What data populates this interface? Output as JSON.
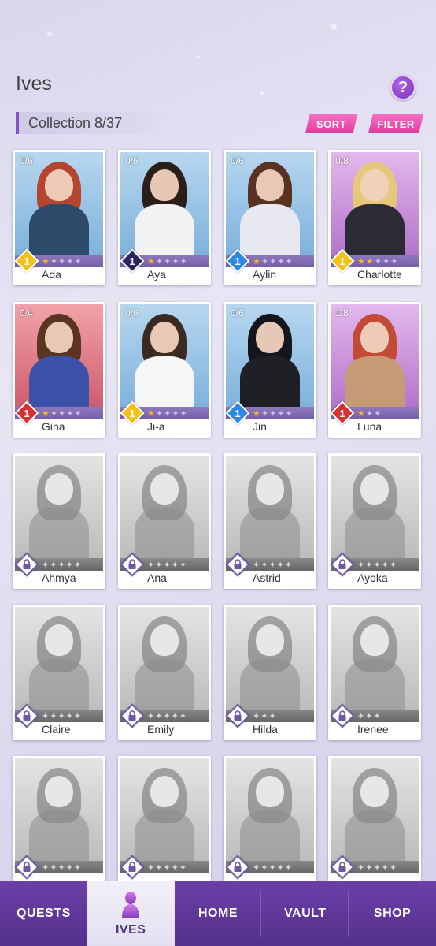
{
  "header": {
    "title": "Ives",
    "help_label": "?",
    "collection_label": "Collection 8/37",
    "sort_label": "SORT",
    "filter_label": "FILTER"
  },
  "colors": {
    "accent": "#7e54c8",
    "pill": "#e94aa8",
    "nav": "#5f37a0",
    "rarity_yellow": "#f3c21a",
    "rarity_navy": "#2a2560",
    "rarity_blue": "#2f88e0",
    "rarity_red": "#d63232"
  },
  "characters": [
    {
      "name": "Ada",
      "progress": "0/6",
      "level": "1",
      "rarity": "yellow",
      "stars_on": 1,
      "stars_total": 5,
      "bg": "blue",
      "locked": false,
      "hair": "#b5452e",
      "outfit": "#2d4a6a"
    },
    {
      "name": "Aya",
      "progress": "0/6",
      "level": "1",
      "rarity": "navy",
      "stars_on": 1,
      "stars_total": 5,
      "bg": "blue",
      "locked": false,
      "hair": "#2b1e18",
      "outfit": "#f2f2f2"
    },
    {
      "name": "Aylin",
      "progress": "0/6",
      "level": "1",
      "rarity": "blue",
      "stars_on": 1,
      "stars_total": 5,
      "bg": "blue",
      "locked": false,
      "hair": "#5a3224",
      "outfit": "#e8e8f0"
    },
    {
      "name": "Charlotte",
      "progress": "0/8",
      "level": "1",
      "rarity": "yellow",
      "stars_on": 2,
      "stars_total": 5,
      "bg": "purple",
      "locked": false,
      "hair": "#e7c77a",
      "outfit": "#2b2b36"
    },
    {
      "name": "Gina",
      "progress": "0/4",
      "level": "1",
      "rarity": "red",
      "stars_on": 1,
      "stars_total": 5,
      "bg": "red",
      "locked": false,
      "hair": "#5b3524",
      "outfit": "#3c52a8"
    },
    {
      "name": "Ji-a",
      "progress": "0/6",
      "level": "1",
      "rarity": "yellow",
      "stars_on": 1,
      "stars_total": 5,
      "bg": "blue",
      "locked": false,
      "hair": "#3a2a22",
      "outfit": "#f6f6f6"
    },
    {
      "name": "Jin",
      "progress": "0/6",
      "level": "1",
      "rarity": "blue",
      "stars_on": 1,
      "stars_total": 5,
      "bg": "blue",
      "locked": false,
      "hair": "#15151c",
      "outfit": "#1f1f26"
    },
    {
      "name": "Luna",
      "progress": "1/8",
      "level": "1",
      "rarity": "red",
      "stars_on": 1,
      "stars_total": 3,
      "bg": "purple",
      "locked": false,
      "hair": "#c34a34",
      "outfit": "#c59a74"
    },
    {
      "name": "Ahmya",
      "locked": true,
      "stars_on": 0,
      "stars_total": 5,
      "bg": "gray"
    },
    {
      "name": "Ana",
      "locked": true,
      "stars_on": 0,
      "stars_total": 5,
      "bg": "gray"
    },
    {
      "name": "Astrid",
      "locked": true,
      "stars_on": 0,
      "stars_total": 5,
      "bg": "gray"
    },
    {
      "name": "Ayoka",
      "locked": true,
      "stars_on": 0,
      "stars_total": 5,
      "bg": "gray"
    },
    {
      "name": "Claire",
      "locked": true,
      "stars_on": 0,
      "stars_total": 5,
      "bg": "gray"
    },
    {
      "name": "Emily",
      "locked": true,
      "stars_on": 0,
      "stars_total": 5,
      "bg": "gray"
    },
    {
      "name": "Hilda",
      "locked": true,
      "stars_on": 0,
      "stars_total": 3,
      "bg": "gray"
    },
    {
      "name": "Irenee",
      "locked": true,
      "stars_on": 0,
      "stars_total": 3,
      "bg": "gray"
    },
    {
      "name": "",
      "locked": true,
      "stars_on": 0,
      "stars_total": 5,
      "bg": "gray"
    },
    {
      "name": "",
      "locked": true,
      "stars_on": 0,
      "stars_total": 5,
      "bg": "gray"
    },
    {
      "name": "",
      "locked": true,
      "stars_on": 0,
      "stars_total": 5,
      "bg": "gray"
    },
    {
      "name": "",
      "locked": true,
      "stars_on": 0,
      "stars_total": 5,
      "bg": "gray"
    }
  ],
  "nav": {
    "items": [
      {
        "label": "QUESTS",
        "active": false
      },
      {
        "label": "IVES",
        "active": true,
        "icon": "woman-silhouette-icon"
      },
      {
        "label": "HOME",
        "active": false
      },
      {
        "label": "VAULT",
        "active": false
      },
      {
        "label": "SHOP",
        "active": false
      }
    ]
  }
}
